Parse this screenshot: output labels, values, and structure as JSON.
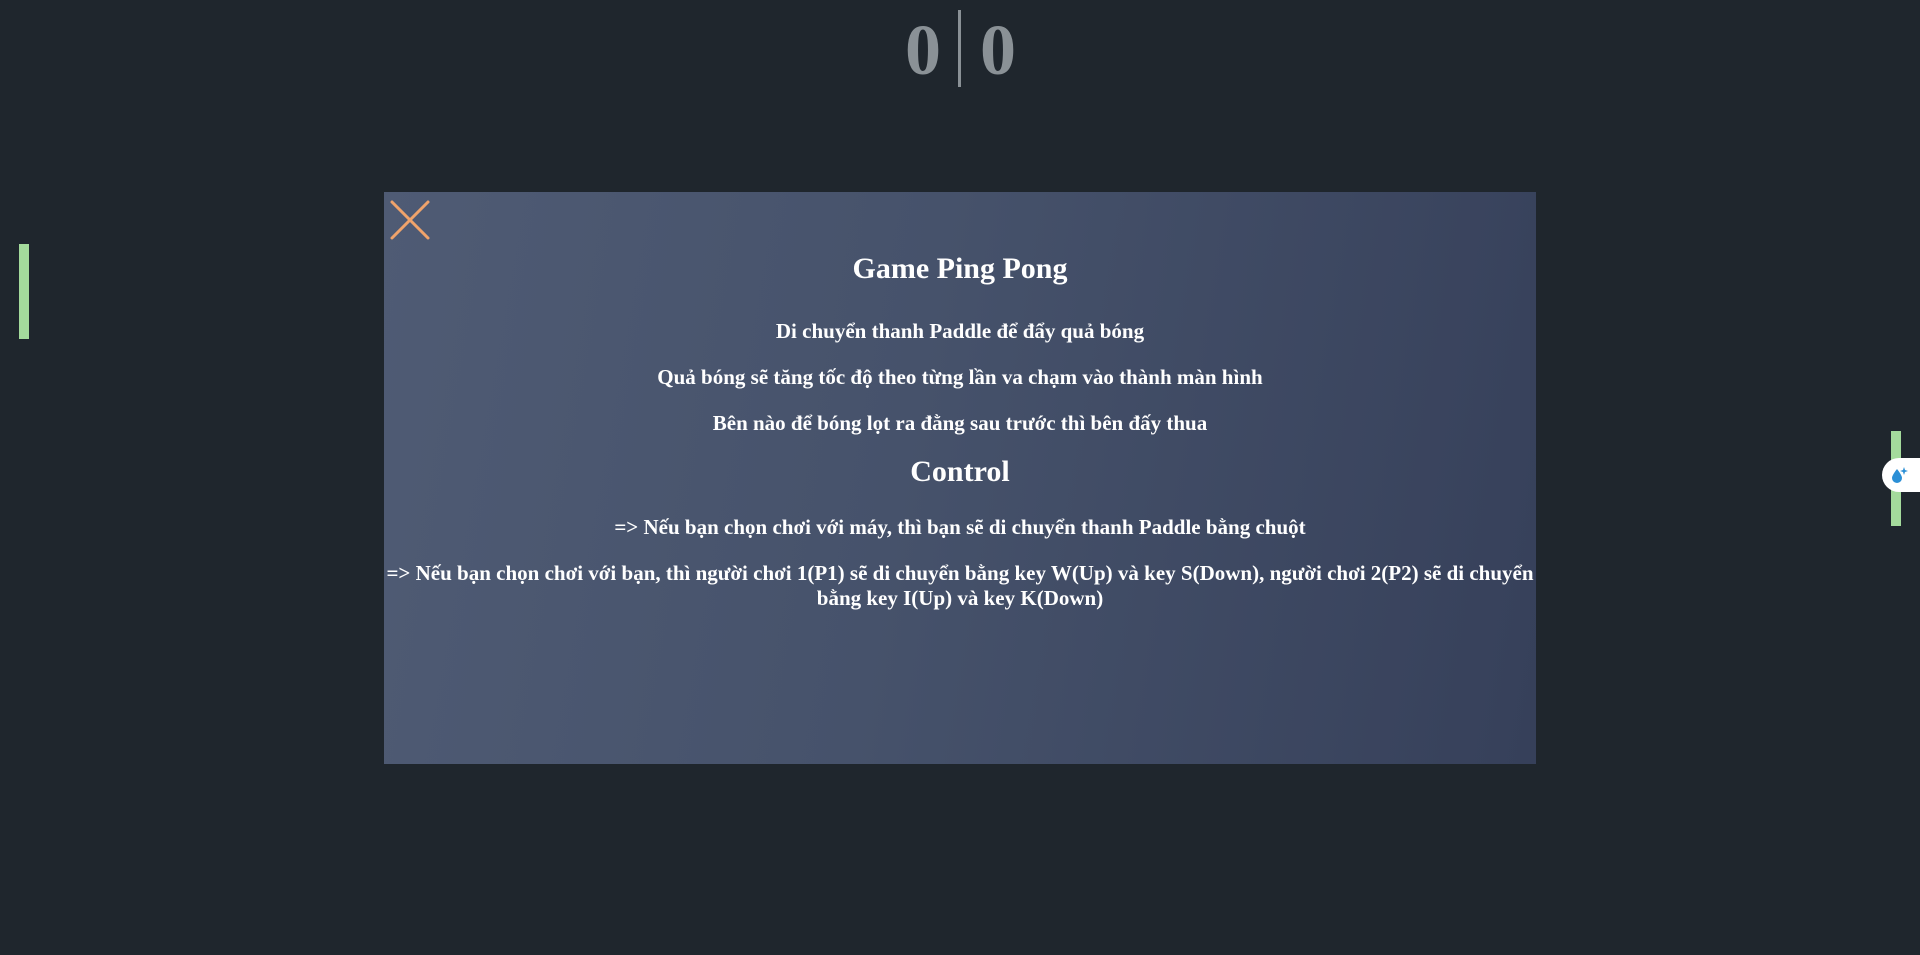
{
  "scoreboard": {
    "left_score": "0",
    "right_score": "0"
  },
  "modal": {
    "close_icon": "close-icon",
    "title": "Game Ping Pong",
    "rules": [
      "Di chuyển thanh Paddle để đẩy quả bóng",
      "Quả bóng sẽ tăng tốc độ theo từng lần va chạm vào thành màn hình",
      "Bên nào để bóng lọt ra đằng sau trước thì bên đấy thua"
    ],
    "control_title": "Control",
    "controls": [
      "=> Nếu bạn chọn chơi với máy, thì bạn sẽ di chuyển thanh Paddle bằng chuột",
      "=> Nếu bạn chọn chơi với bạn, thì người chơi 1(P1) sẽ di chuyển bằng key W(Up) và key S(Down), người chơi 2(P2) sẽ di chuyển bằng key I(Up) và key K(Down)"
    ]
  },
  "extension": {
    "icon": "water-drop-sparkle-icon"
  },
  "colors": {
    "background": "#1f262d",
    "paddle": "#a4db9c",
    "score": "#8a9196",
    "close_icon": "#f0a36b",
    "modal_gradient_start": "#4f5b74",
    "modal_gradient_end": "#36405a"
  }
}
